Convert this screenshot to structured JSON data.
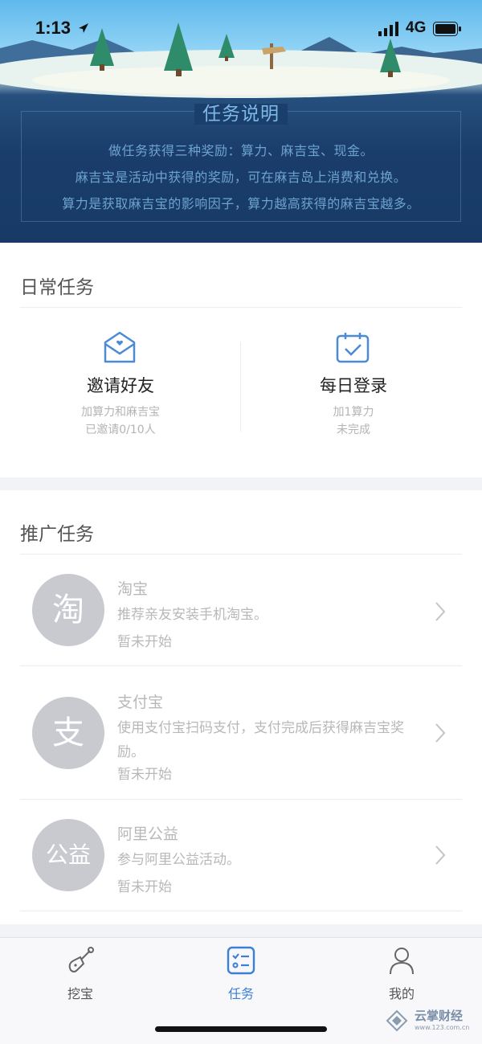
{
  "status_bar": {
    "time": "1:13",
    "network": "4G"
  },
  "hero": {
    "title": "任务说明",
    "lines": [
      "做任务获得三种奖励：算力、麻吉宝、现金。",
      "麻吉宝是活动中获得的奖励，可在麻吉岛上消费和兑换。",
      "算力是获取麻吉宝的影响因子，算力越高获得的麻吉宝越多。"
    ]
  },
  "daily": {
    "title": "日常任务",
    "tasks": [
      {
        "name": "邀请好友",
        "reward": "加算力和麻吉宝",
        "status": "已邀请0/10人",
        "icon": "envelope-heart-icon"
      },
      {
        "name": "每日登录",
        "reward": "加1算力",
        "status": "未完成",
        "icon": "calendar-check-icon"
      }
    ]
  },
  "promo": {
    "title": "推广任务",
    "tasks": [
      {
        "badge": "淘",
        "name": "淘宝",
        "desc": "推荐亲友安装手机淘宝。",
        "status": "暂未开始"
      },
      {
        "badge": "支",
        "name": "支付宝",
        "desc": "使用支付宝扫码支付，支付完成后获得麻吉宝奖励。",
        "status": "暂未开始"
      },
      {
        "badge": "公益",
        "name": "阿里公益",
        "desc": "参与阿里公益活动。",
        "status": "暂未开始"
      }
    ]
  },
  "tabbar": {
    "tabs": [
      {
        "label": "挖宝",
        "icon": "shovel-icon",
        "active": false
      },
      {
        "label": "任务",
        "icon": "task-list-icon",
        "active": true
      },
      {
        "label": "我的",
        "icon": "user-icon",
        "active": false
      }
    ]
  },
  "watermark": {
    "text": "云掌财经",
    "url": "www.123.com.cn"
  },
  "colors": {
    "accent": "#3b7fd6",
    "hero_dark": "#173a66",
    "muted": "#b8b8b8"
  }
}
